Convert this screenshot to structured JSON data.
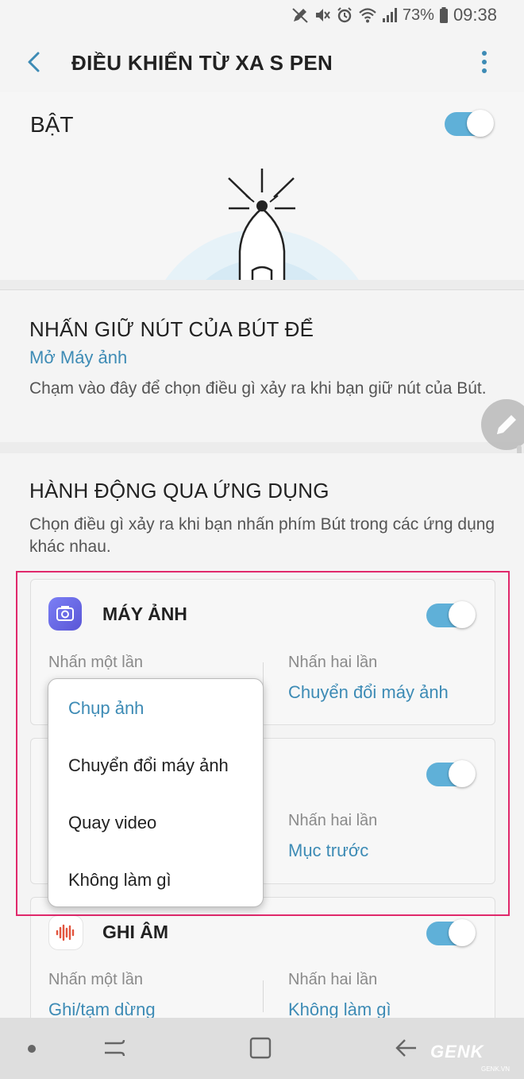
{
  "status_bar": {
    "battery": "73%",
    "time": "09:38"
  },
  "app_bar": {
    "title": "ĐIỀU KHIỂN TỪ XA S PEN"
  },
  "master": {
    "label": "BẬT",
    "enabled": true
  },
  "press_hold": {
    "heading": "NHẤN GIỮ NÚT CỦA BÚT ĐỂ",
    "value": "Mở Máy ảnh",
    "description": "Chạm vào đây để chọn điều gì xảy ra khi bạn giữ nút của Bút."
  },
  "app_actions": {
    "heading": "HÀNH ĐỘNG QUA ỨNG DỤNG",
    "description": "Chọn điều gì xảy ra khi bạn nhấn phím Bút trong các ứng dụng khác nhau."
  },
  "cards": [
    {
      "name": "MÁY ẢNH",
      "enabled": true,
      "single_label": "Nhấn một lần",
      "single_value": "",
      "double_label": "Nhấn hai lần",
      "double_value": "Chuyển đổi máy ảnh"
    },
    {
      "name": "",
      "enabled": true,
      "single_label": "",
      "single_value": "",
      "double_label": "Nhấn hai lần",
      "double_value": "Mục trước"
    },
    {
      "name": "GHI ÂM",
      "enabled": true,
      "single_label": "Nhấn một lần",
      "single_value": "Ghi/tạm dừng",
      "double_label": "Nhấn hai lần",
      "double_value": "Không làm gì"
    }
  ],
  "popup_menu": {
    "items": [
      "Chụp ảnh",
      "Chuyển đổi máy ảnh",
      "Quay video",
      "Không làm gì"
    ],
    "selected_index": 0
  },
  "watermark": {
    "brand": "GENK",
    "sub": "GENK.VN"
  },
  "colors": {
    "accent": "#3d8bb5",
    "toggle_on": "#5fb0d8",
    "highlight": "#e0286b"
  }
}
